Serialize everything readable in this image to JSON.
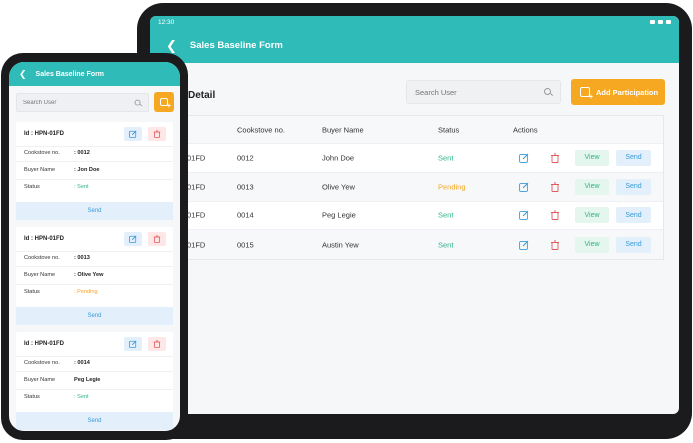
{
  "colors": {
    "header": "#2fbcb8",
    "accent": "#f7a823",
    "sent": "#2bb48c",
    "pending": "#f5a623",
    "send_btn": "#3a9ad9"
  },
  "tablet": {
    "status_time": "12:30",
    "title": "Sales Baseline Form",
    "section_title": "Detail",
    "search_placeholder": "Search User",
    "add_button": "Add Participation",
    "columns": [
      "Cookstove no.",
      "Buyer Name",
      "Status",
      "Actions"
    ],
    "rows": [
      {
        "id": "01FD",
        "cookstove": "0012",
        "buyer": "John Doe",
        "status": "Sent"
      },
      {
        "id": "01FD",
        "cookstove": "0013",
        "buyer": "Olive Yew",
        "status": "Pending"
      },
      {
        "id": "01FD",
        "cookstove": "0014",
        "buyer": "Peg Legie",
        "status": "Sent"
      },
      {
        "id": "01FD",
        "cookstove": "0015",
        "buyer": "Austin Yew",
        "status": "Sent"
      }
    ],
    "view_label": "View",
    "send_label": "Send"
  },
  "phone": {
    "title": "Sales Baseline Form",
    "search_placeholder": "Search User",
    "labels": {
      "cookstove": "Cookstove no.",
      "buyer": "Buyer Name",
      "status": "Status"
    },
    "cards": [
      {
        "id": "Id : HPN-01FD",
        "cookstove": ": 0012",
        "buyer": ": Jon Doe",
        "status": ": Sent"
      },
      {
        "id": "Id : HPN-01FD",
        "cookstove": ": 0013",
        "buyer": ": Olive Yew",
        "status": ": Pending"
      },
      {
        "id": "Id : HPN-01FD",
        "cookstove": ": 0014",
        "buyer": "Peg Legie",
        "status": ": Sent"
      }
    ],
    "send_label": "Send"
  }
}
